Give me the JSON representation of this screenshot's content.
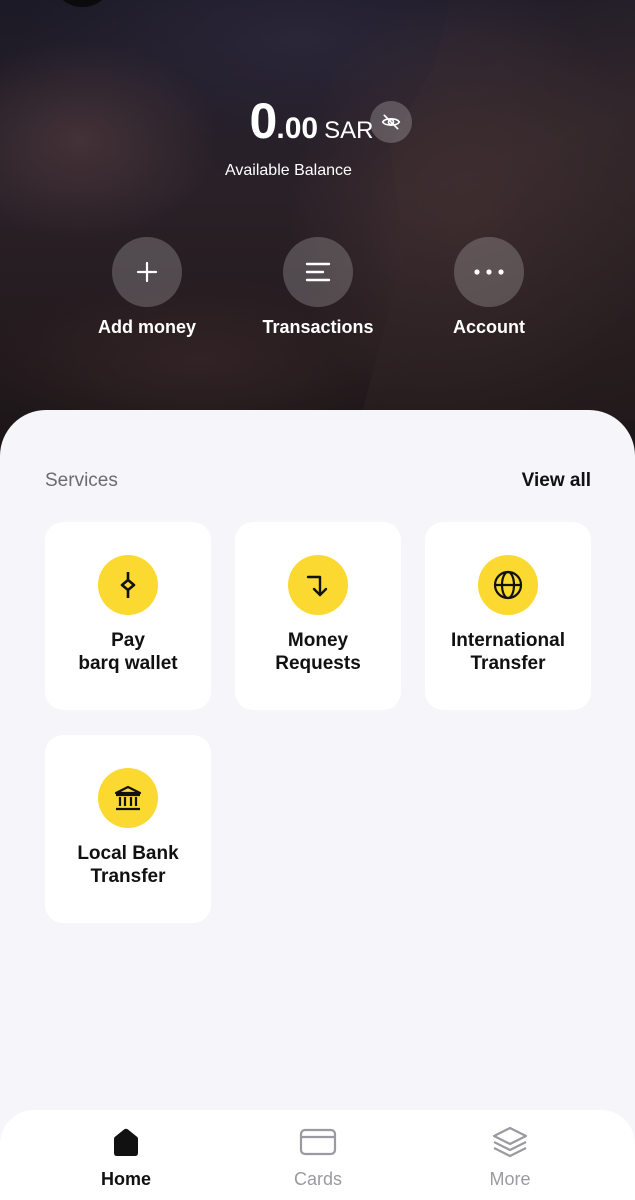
{
  "balance": {
    "integer": "0",
    "decimal": ".00",
    "currency": "SAR",
    "label": "Available Balance"
  },
  "actions": [
    {
      "label": "Add money",
      "icon": "plus-icon"
    },
    {
      "label": "Transactions",
      "icon": "list-icon"
    },
    {
      "label": "Account",
      "icon": "more-dots-icon"
    }
  ],
  "services": {
    "title": "Services",
    "view_all": "View all",
    "items": [
      {
        "line1": "Pay",
        "line2": "barq wallet",
        "icon": "barq-lightning-icon"
      },
      {
        "line1": "Money",
        "line2": "Requests",
        "icon": "arrow-turn-down-icon"
      },
      {
        "line1": "International",
        "line2": "Transfer",
        "icon": "globe-icon"
      },
      {
        "line1": "Local Bank",
        "line2": "Transfer",
        "icon": "bank-icon"
      }
    ]
  },
  "nav": [
    {
      "label": "Home",
      "icon": "home-icon",
      "active": true
    },
    {
      "label": "Cards",
      "icon": "card-icon",
      "active": false
    },
    {
      "label": "More",
      "icon": "layers-icon",
      "active": false
    }
  ],
  "colors": {
    "accent": "#fbd930",
    "sheet_bg": "#f5f5fa",
    "nav_active": "#111111",
    "nav_inactive": "#9a9aa0"
  }
}
